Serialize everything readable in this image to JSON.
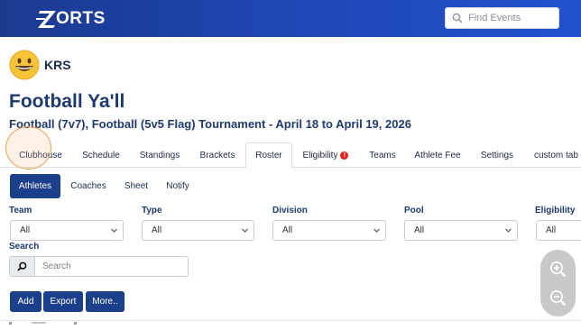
{
  "brand": {
    "logo_text": "ORTS",
    "colors": {
      "header": "#1f48b8",
      "primary": "#1b3f8a",
      "alert": "#e02020"
    }
  },
  "header": {
    "search_placeholder": "Find Events"
  },
  "club": {
    "name": "KRS",
    "avatar_icon": "smiley-icon"
  },
  "event": {
    "title": "Football Ya'll",
    "subtitle": "Football (7v7), Football (5v5 Flag) Tournament  -  April 18 to April 19, 2026"
  },
  "tabs": [
    {
      "label": "Clubhouse"
    },
    {
      "label": "Schedule"
    },
    {
      "label": "Standings"
    },
    {
      "label": "Brackets"
    },
    {
      "label": "Roster",
      "active": true
    },
    {
      "label": "Eligibility",
      "badge": "!"
    },
    {
      "label": "Teams"
    },
    {
      "label": "Athlete Fee"
    },
    {
      "label": "Settings"
    },
    {
      "label": "custom tab"
    }
  ],
  "subtabs": [
    {
      "label": "Athletes",
      "active": true
    },
    {
      "label": "Coaches"
    },
    {
      "label": "Sheet"
    },
    {
      "label": "Notify"
    }
  ],
  "filters": [
    {
      "label": "Team",
      "value": "All"
    },
    {
      "label": "Type",
      "value": "All"
    },
    {
      "label": "Division",
      "value": "All"
    },
    {
      "label": "Pool",
      "value": "All"
    },
    {
      "label": "Eligibility",
      "value": "All"
    }
  ],
  "search": {
    "label": "Search",
    "placeholder": "Search"
  },
  "actions": {
    "add": "Add",
    "export": "Export",
    "more": "More.."
  },
  "zoom": {
    "in_icon": "zoom-in-icon",
    "out_icon": "zoom-out-icon"
  }
}
